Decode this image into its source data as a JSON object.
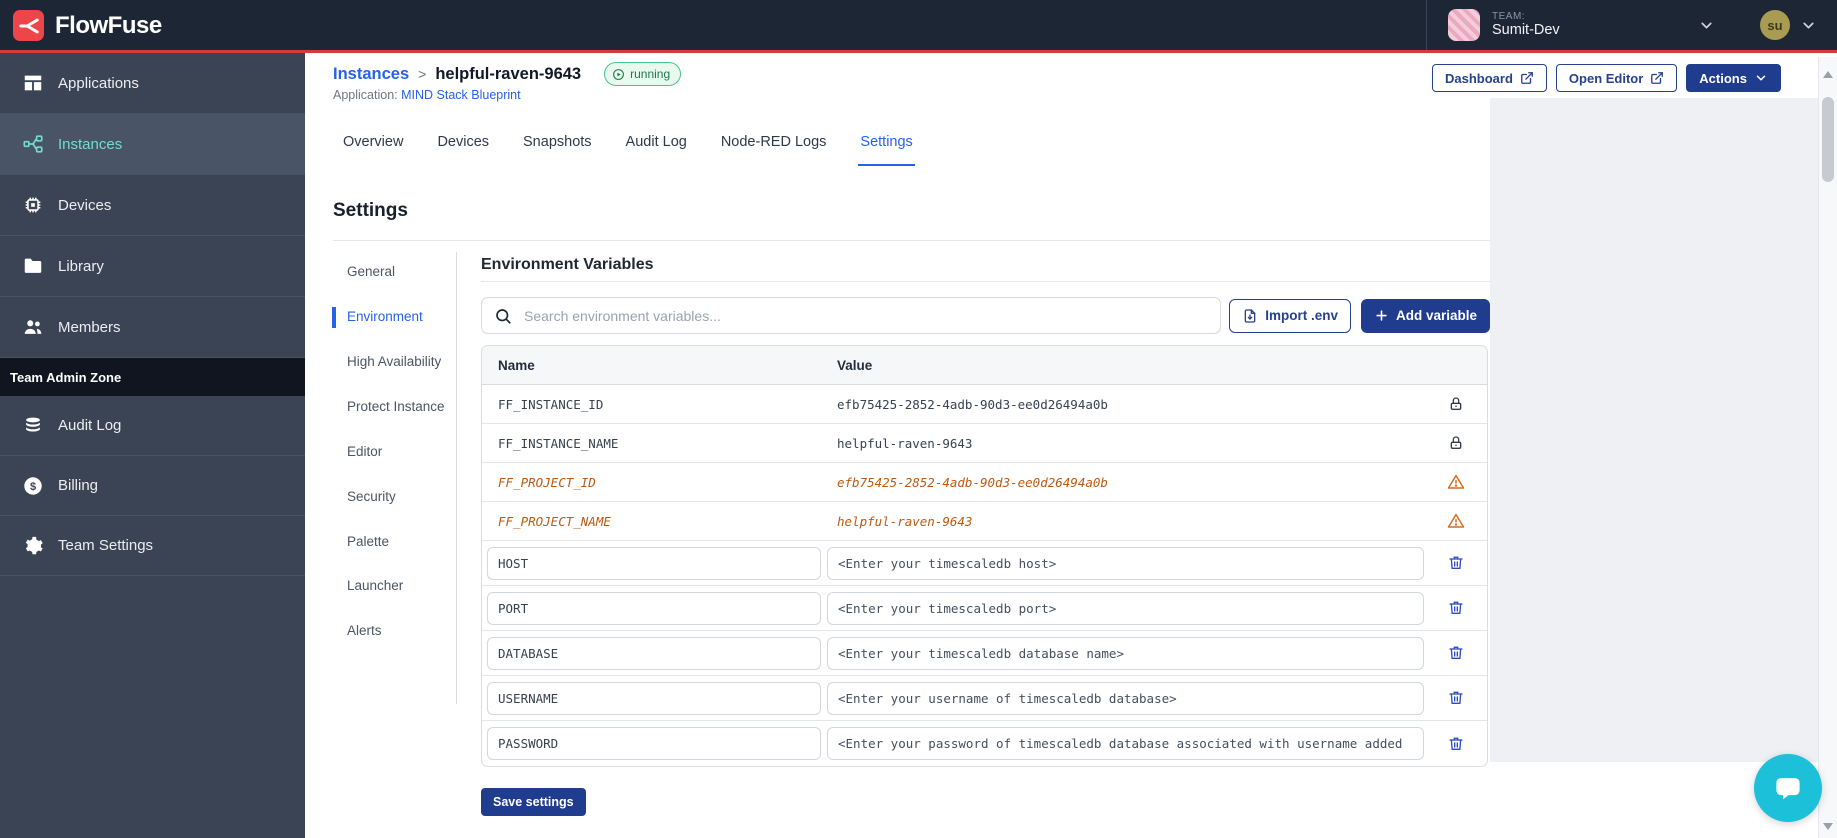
{
  "header": {
    "brand": "FlowFuse",
    "team_label": "TEAM:",
    "team_name": "Sumit-Dev",
    "user_initials": "su"
  },
  "sidebar": {
    "items": [
      {
        "label": "Applications",
        "active": false
      },
      {
        "label": "Instances",
        "active": true
      },
      {
        "label": "Devices",
        "active": false
      },
      {
        "label": "Library",
        "active": false
      },
      {
        "label": "Members",
        "active": false
      }
    ],
    "admin_zone_label": "Team Admin Zone",
    "admin_items": [
      {
        "label": "Audit Log"
      },
      {
        "label": "Billing"
      },
      {
        "label": "Team Settings"
      }
    ]
  },
  "breadcrumb": {
    "parent": "Instances",
    "separator": ">",
    "current": "helpful-raven-9643",
    "status": "running",
    "application_label": "Application:",
    "application_name": "MIND Stack Blueprint"
  },
  "top_actions": {
    "dashboard": "Dashboard",
    "open_editor": "Open Editor",
    "actions": "Actions"
  },
  "tabs": [
    {
      "label": "Overview"
    },
    {
      "label": "Devices"
    },
    {
      "label": "Snapshots"
    },
    {
      "label": "Audit Log"
    },
    {
      "label": "Node-RED Logs"
    },
    {
      "label": "Settings"
    }
  ],
  "settings": {
    "title": "Settings",
    "nav": [
      {
        "label": "General"
      },
      {
        "label": "Environment"
      },
      {
        "label": "High Availability"
      },
      {
        "label": "Protect Instance"
      },
      {
        "label": "Editor"
      },
      {
        "label": "Security"
      },
      {
        "label": "Palette"
      },
      {
        "label": "Launcher"
      },
      {
        "label": "Alerts"
      }
    ]
  },
  "env": {
    "title": "Environment Variables",
    "search_placeholder": "Search environment variables...",
    "import_label": "Import .env",
    "add_label": "Add variable",
    "save_label": "Save settings",
    "columns": {
      "name": "Name",
      "value": "Value"
    },
    "locked_rows": [
      {
        "name": "FF_INSTANCE_ID",
        "value": "efb75425-2852-4adb-90d3-ee0d26494a0b"
      },
      {
        "name": "FF_INSTANCE_NAME",
        "value": "helpful-raven-9643"
      }
    ],
    "deprecated_rows": [
      {
        "name": "FF_PROJECT_ID",
        "value": "efb75425-2852-4adb-90d3-ee0d26494a0b"
      },
      {
        "name": "FF_PROJECT_NAME",
        "value": "helpful-raven-9643"
      }
    ],
    "editable_rows": [
      {
        "name": "HOST",
        "value": "<Enter your timescaledb host>"
      },
      {
        "name": "PORT",
        "value": "<Enter your timescaledb port>"
      },
      {
        "name": "DATABASE",
        "value": "<Enter your timescaledb database name>"
      },
      {
        "name": "USERNAME",
        "value": "<Enter your username of timescaledb database>"
      },
      {
        "name": "PASSWORD",
        "value": "<Enter your password of timescaledb database associated with username added"
      }
    ]
  },
  "colors": {
    "brand_red": "#ee4648",
    "header_bg": "#1d2634",
    "sidebar_bg": "#3b4454",
    "accent_line": "#d63a40",
    "primary_indigo": "#203c8f",
    "link_blue": "#2563eb",
    "active_teal": "#74dcd1",
    "running_green": "#1d7a4c",
    "deprecated_orange": "#bc5a12",
    "warning_orange": "#d96c1f",
    "trash_blue": "#2d4cbe",
    "chat_cyan": "#1cc0d8"
  }
}
